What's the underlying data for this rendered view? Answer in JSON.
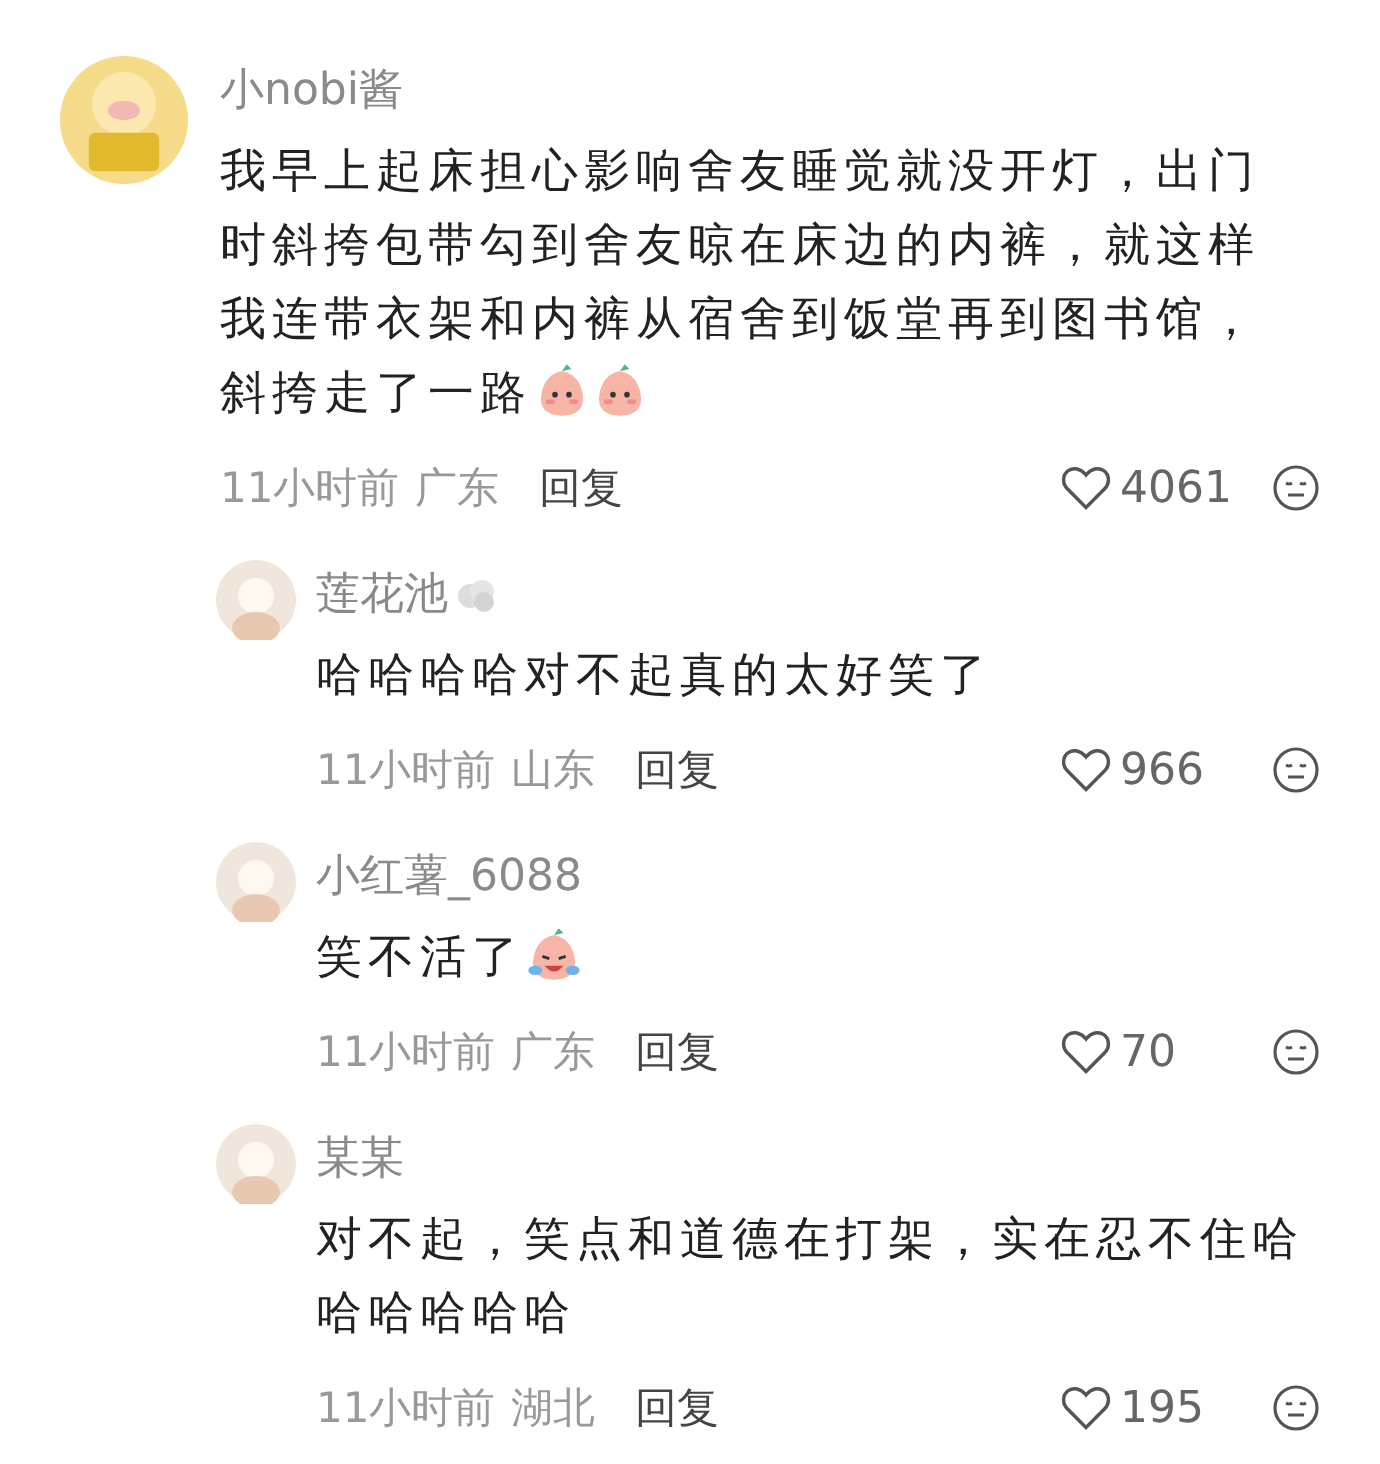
{
  "comments": [
    {
      "author": "小nobi酱",
      "text": "我早上起床担心影响舍友睡觉就没开灯，出门时斜挎包带勾到舍友晾在床边的内裤，就这样我连带衣架和内裤从宿舍到饭堂再到图书馆，斜挎走了一路",
      "emojis": [
        {
          "kind": "peach"
        },
        {
          "kind": "peach"
        }
      ],
      "time": "11小时前",
      "location": "广东",
      "reply": "回复",
      "likes": "4061",
      "replies": [
        {
          "author": "莲花池",
          "badge": {
            "kind": "cloud"
          },
          "text": "哈哈哈哈对不起真的太好笑了",
          "time": "11小时前",
          "location": "山东",
          "reply": "回复",
          "likes": "966"
        },
        {
          "author": "小红薯_6088",
          "text": "笑不活了",
          "emojis": [
            {
              "kind": "crying"
            }
          ],
          "time": "11小时前",
          "location": "广东",
          "reply": "回复",
          "likes": "70"
        },
        {
          "author": "某某",
          "text": "对不起，笑点和道德在打架，实在忍不住哈哈哈哈哈哈",
          "time": "11小时前",
          "location": "湖北",
          "reply": "回复",
          "likes": "195"
        }
      ]
    }
  ]
}
